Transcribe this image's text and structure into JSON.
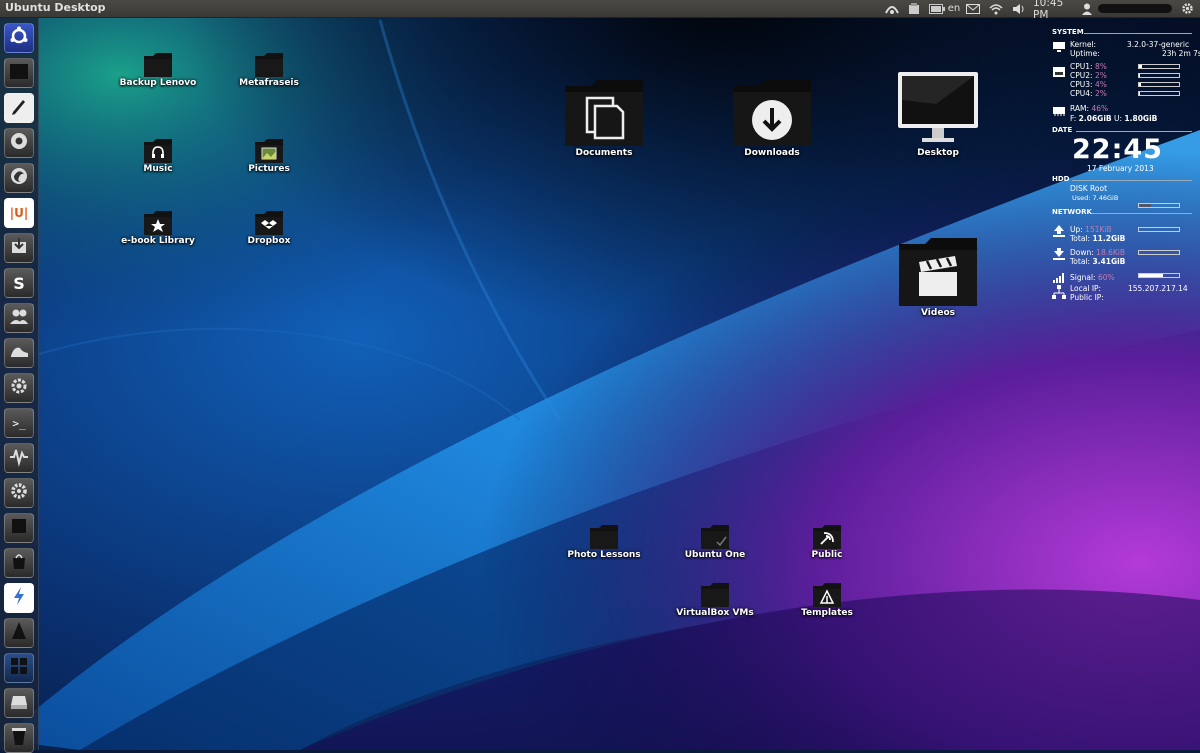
{
  "panel": {
    "title": "Ubuntu Desktop",
    "keyboard": "en",
    "time": "10:45 PM"
  },
  "launcher": {
    "items": [
      {
        "name": "dash-home",
        "icon": "ubuntu-logo-icon"
      },
      {
        "name": "files",
        "icon": "folder-icon"
      },
      {
        "name": "text-editor",
        "icon": "pencil-icon"
      },
      {
        "name": "chrome",
        "icon": "chrome-icon"
      },
      {
        "name": "firefox",
        "icon": "firefox-icon"
      },
      {
        "name": "ubuntu-tweak",
        "icon": "bracket-u-icon",
        "glyph": "|U|"
      },
      {
        "name": "package-manager",
        "icon": "box-icon"
      },
      {
        "name": "skype",
        "icon": "skype-icon",
        "glyph": "S"
      },
      {
        "name": "contacts",
        "icon": "people-icon"
      },
      {
        "name": "inkscape",
        "icon": "shoe-icon"
      },
      {
        "name": "settings-app",
        "icon": "gear-box-icon"
      },
      {
        "name": "terminal",
        "icon": "terminal-icon",
        "glyph": ">_"
      },
      {
        "name": "system-monitor",
        "icon": "pulse-icon"
      },
      {
        "name": "system-settings",
        "icon": "gear-icon"
      },
      {
        "name": "workspace-app",
        "icon": "square-icon"
      },
      {
        "name": "software-center",
        "icon": "bag-icon"
      },
      {
        "name": "flash-app",
        "icon": "lightning-icon"
      },
      {
        "name": "vlc",
        "icon": "cone-icon"
      },
      {
        "name": "workspace-switcher",
        "icon": "grid-icon"
      },
      {
        "name": "drive",
        "icon": "drive-icon"
      },
      {
        "name": "trash",
        "icon": "trash-icon"
      }
    ]
  },
  "desktop": {
    "icons": [
      {
        "label": "Backup Lenovo",
        "glyph": "folder"
      },
      {
        "label": "Metafraseis",
        "glyph": "folder"
      },
      {
        "label": "Music",
        "glyph": "headphones"
      },
      {
        "label": "Pictures",
        "glyph": "picture"
      },
      {
        "label": "e-book Library",
        "glyph": "star"
      },
      {
        "label": "Dropbox",
        "glyph": "dropbox"
      },
      {
        "label": "Documents",
        "glyph": "documents"
      },
      {
        "label": "Downloads",
        "glyph": "download"
      },
      {
        "label": "Desktop",
        "glyph": "monitor"
      },
      {
        "label": "Videos",
        "glyph": "clapper"
      },
      {
        "label": "Photo Lessons",
        "glyph": "folder"
      },
      {
        "label": "Ubuntu One",
        "glyph": "check"
      },
      {
        "label": "Public",
        "glyph": "share"
      },
      {
        "label": "VirtualBox VMs",
        "glyph": "folder"
      },
      {
        "label": "Templates",
        "glyph": "template"
      }
    ]
  },
  "conky": {
    "system": {
      "heading": "SYSTEM",
      "kernel_label": "Kernel:",
      "kernel_value": "3.2.0-37-generic",
      "uptime_label": "Uptime:",
      "uptime_value": "23h 2m 7s",
      "cpus": [
        {
          "label": "CPU1:",
          "pct": "8%",
          "level": 0.08
        },
        {
          "label": "CPU2:",
          "pct": "2%",
          "level": 0.02
        },
        {
          "label": "CPU3:",
          "pct": "4%",
          "level": 0.04
        },
        {
          "label": "CPU4:",
          "pct": "2%",
          "level": 0.02
        }
      ],
      "ram_label": "RAM:",
      "ram_pct": "46%",
      "free_label": "F:",
      "free_value": "2.06GiB",
      "used_label": "U:",
      "used_value": "1.80GiB"
    },
    "date": {
      "heading": "DATE",
      "clock": "22:45",
      "date": "17 February 2013"
    },
    "hdd": {
      "heading": "HDD",
      "disk": "DISK Root",
      "used_label": "Used:",
      "used_value": "7.46GiB",
      "level": 0.3
    },
    "network": {
      "heading": "NETWORK",
      "up_label": "Up:",
      "up_value": "151KiB",
      "up_total_label": "Total:",
      "up_total_value": "11.2GiB",
      "down_label": "Down:",
      "down_value": "18.6KiB",
      "down_total_label": "Total:",
      "down_total_value": "3.41GiB",
      "signal_label": "Signal:",
      "signal_pct": "60%",
      "signal_level": 0.6,
      "local_ip_label": "Local IP:",
      "local_ip_value": "155.207.217.14",
      "public_ip_label": "Public IP:"
    }
  }
}
